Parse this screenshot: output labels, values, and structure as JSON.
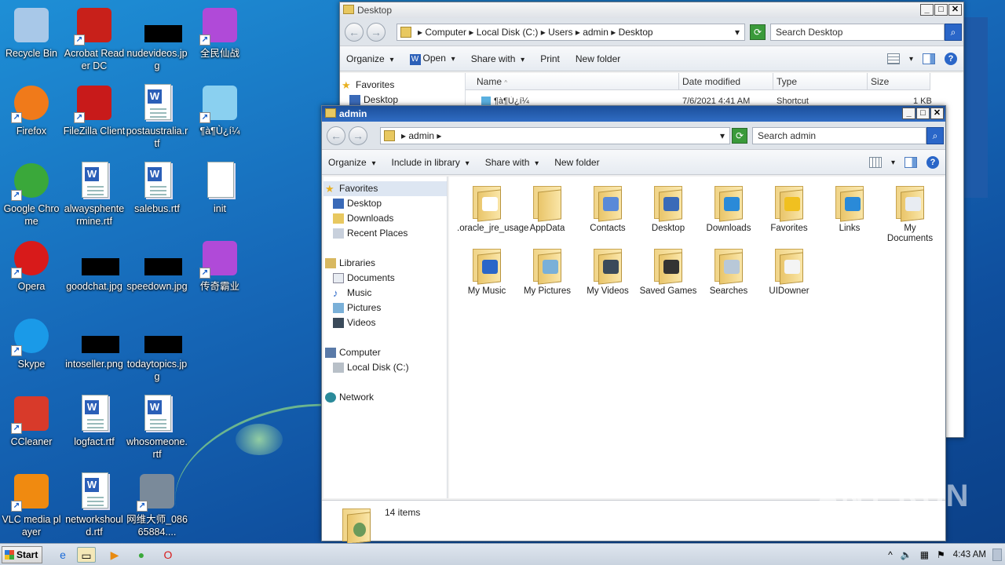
{
  "desktop": {
    "icons": [
      {
        "label": "Recycle Bin",
        "icon": "recycle-bin-icon"
      },
      {
        "label": "Acrobat Reader DC",
        "icon": "acrobat-icon"
      },
      {
        "label": "nudevideos.jpg",
        "icon": "image-file-icon"
      },
      {
        "label": "全民仙战",
        "icon": "game-icon"
      },
      {
        "label": "Firefox",
        "icon": "firefox-icon"
      },
      {
        "label": "FileZilla Client",
        "icon": "filezilla-icon"
      },
      {
        "label": "postaustralia.rtf",
        "icon": "word-doc-icon"
      },
      {
        "label": "¶à¶Ù¿í¼",
        "icon": "image-icon"
      },
      {
        "label": "Google Chrome",
        "icon": "chrome-icon"
      },
      {
        "label": "alwaysphentermine.rtf",
        "icon": "word-doc-icon"
      },
      {
        "label": "salebus.rtf",
        "icon": "word-doc-icon"
      },
      {
        "label": "init",
        "icon": "blank-file-icon"
      },
      {
        "label": "Opera",
        "icon": "opera-icon"
      },
      {
        "label": "goodchat.jpg",
        "icon": "image-file-icon"
      },
      {
        "label": "speedown.jpg",
        "icon": "image-file-icon"
      },
      {
        "label": "传奇霸业",
        "icon": "game-icon"
      },
      {
        "label": "Skype",
        "icon": "skype-icon"
      },
      {
        "label": "intoseller.png",
        "icon": "image-file-icon"
      },
      {
        "label": "todaytopics.jpg",
        "icon": "image-file-icon"
      },
      {
        "label": "CCleaner",
        "icon": "ccleaner-icon"
      },
      {
        "label": "logfact.rtf",
        "icon": "word-doc-icon"
      },
      {
        "label": "whosomeone.rtf",
        "icon": "word-doc-icon"
      },
      {
        "label": "VLC media player",
        "icon": "vlc-icon"
      },
      {
        "label": "networkshould.rtf",
        "icon": "word-doc-icon"
      },
      {
        "label": "网维大师_08665884....",
        "icon": "installer-icon"
      }
    ]
  },
  "window_desktop": {
    "title": "Desktop",
    "breadcrumb": [
      "Computer",
      "Local Disk (C:)",
      "Users",
      "admin",
      "Desktop"
    ],
    "search_placeholder": "Search Desktop",
    "commands": [
      "Organize",
      "Open",
      "Share with",
      "Print",
      "New folder"
    ],
    "nav": {
      "favorites": "Favorites",
      "desktop": "Desktop"
    },
    "columns": [
      "Name",
      "Date modified",
      "Type",
      "Size"
    ],
    "row": {
      "name": "¶à¶Ù¿í¼",
      "date": "7/6/2021 4:41 AM",
      "type": "Shortcut",
      "size": "1 KB"
    }
  },
  "window_admin": {
    "title": "admin",
    "breadcrumb": [
      "admin"
    ],
    "search_placeholder": "Search admin",
    "commands": [
      "Organize",
      "Include in library",
      "Share with",
      "New folder"
    ],
    "nav": {
      "favorites": "Favorites",
      "fav_items": [
        "Desktop",
        "Downloads",
        "Recent Places"
      ],
      "libraries": "Libraries",
      "lib_items": [
        "Documents",
        "Music",
        "Pictures",
        "Videos"
      ],
      "computer": "Computer",
      "computer_items": [
        "Local Disk (C:)"
      ],
      "network": "Network"
    },
    "items": [
      ".oracle_jre_usage",
      "AppData",
      "Contacts",
      "Desktop",
      "Downloads",
      "Favorites",
      "Links",
      "My Documents",
      "My Music",
      "My Pictures",
      "My Videos",
      "Saved Games",
      "Searches",
      "UIDowner"
    ],
    "status": "14 items"
  },
  "taskbar": {
    "start": "Start",
    "clock": "4:43 AM"
  },
  "watermark": "ANY RUN"
}
